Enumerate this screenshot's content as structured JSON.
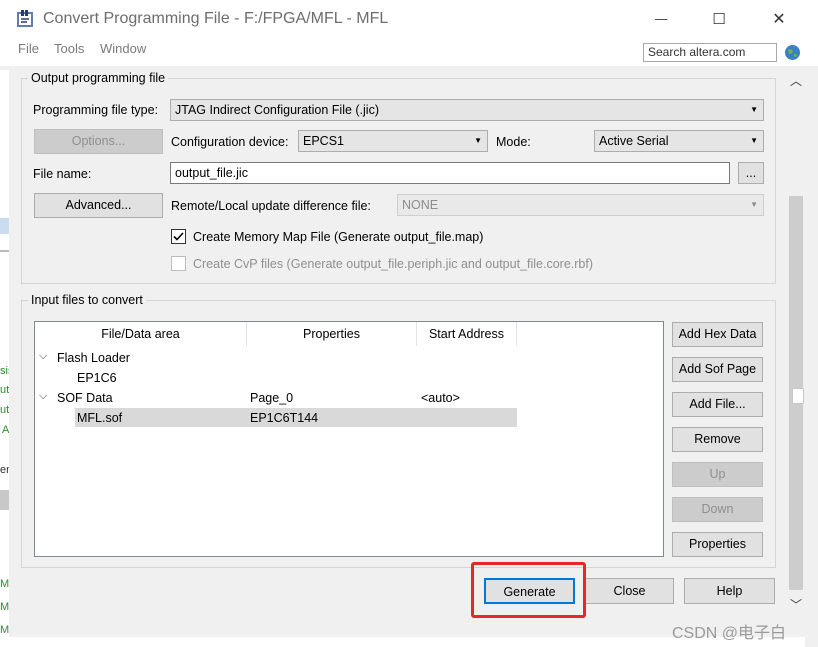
{
  "window": {
    "title": "Convert Programming File - F:/FPGA/MFL - MFL",
    "minimize_glyph": "—",
    "maximize_glyph": "☐",
    "close_glyph": "✕"
  },
  "menu": {
    "file": "File",
    "tools": "Tools",
    "window": "Window"
  },
  "search": {
    "placeholder": "Search altera.com"
  },
  "output_group": {
    "title": "Output programming file",
    "file_type_label": "Programming file type:",
    "file_type_value": "JTAG Indirect Configuration File (.jic)",
    "options_button": "Options...",
    "config_device_label": "Configuration device:",
    "config_device_value": "EPCS1",
    "mode_label": "Mode:",
    "mode_value": "Active Serial",
    "file_name_label": "File name:",
    "file_name_value": "output_file.jic",
    "browse_button": "...",
    "advanced_button": "Advanced...",
    "remote_label": "Remote/Local update difference file:",
    "remote_value": "NONE",
    "memory_map_label": "Create Memory Map File (Generate output_file.map)",
    "memory_map_checked": true,
    "cvp_label": "Create CvP files (Generate output_file.periph.jic and output_file.core.rbf)"
  },
  "input_group": {
    "title": "Input files to convert",
    "columns": [
      "File/Data area",
      "Properties",
      "Start Address"
    ],
    "rows": [
      {
        "name": "Flash Loader",
        "properties": "",
        "address": ""
      },
      {
        "name": "EP1C6",
        "properties": "",
        "address": ""
      },
      {
        "name": "SOF Data",
        "properties": "Page_0",
        "address": "<auto>"
      },
      {
        "name": "MFL.sof",
        "properties": "EP1C6T144",
        "address": ""
      }
    ],
    "buttons": {
      "add_hex": "Add Hex Data",
      "add_sof": "Add Sof Page",
      "add_file": "Add File...",
      "remove": "Remove",
      "up": "Up",
      "down": "Down",
      "properties": "Properties"
    }
  },
  "footer": {
    "generate": "Generate",
    "close": "Close",
    "help": "Help"
  },
  "background_strip": [
    "sis",
    "ut",
    "ut",
    "A",
    "en",
    "Ma",
    "Ma",
    "Ma"
  ],
  "watermark": "CSDN @电子白",
  "colors": {
    "highlight": "#e8262b",
    "selected_row": "#d9d9d9"
  }
}
